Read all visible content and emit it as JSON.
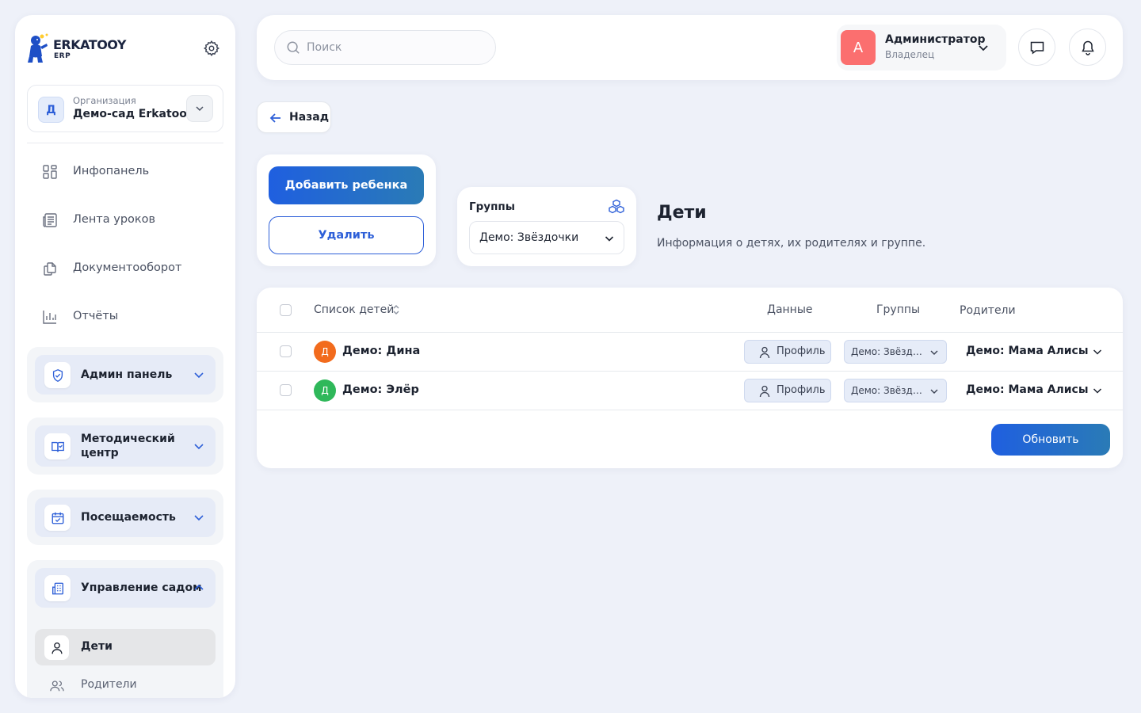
{
  "brand": {
    "name": "ERKATOOY",
    "sub": "ERP"
  },
  "org": {
    "caption": "Организация",
    "name": "Демо-сад Erkatooy",
    "avatar_letter": "Д"
  },
  "nav": {
    "items": [
      {
        "label": "Инфопанель",
        "icon": "dashboard-icon"
      },
      {
        "label": "Лента уроков",
        "icon": "news-feed-icon"
      },
      {
        "label": "Документооборот",
        "icon": "documents-icon"
      },
      {
        "label": "Отчёты",
        "icon": "chart-icon"
      }
    ],
    "groups": [
      {
        "label": "Админ панель",
        "icon": "shield-icon"
      },
      {
        "label_line1": "Методический",
        "label_line2": "центр",
        "icon": "book-icon"
      },
      {
        "label": "Посещаемость",
        "icon": "calendar-check-icon"
      },
      {
        "label": "Управление садом",
        "icon": "building-icon",
        "children": [
          {
            "label": "Дети",
            "active": true
          },
          {
            "label": "Родители",
            "active": false
          }
        ]
      }
    ]
  },
  "header": {
    "search_placeholder": "Поиск",
    "user": {
      "avatar_letter": "А",
      "name": "Администратор",
      "role": "Владелец"
    }
  },
  "page": {
    "back_label": "Назад",
    "add_child_label": "Добавить ребенка",
    "delete_label": "Удалить",
    "groups_title": "Группы",
    "groups_selected": "Демо: Звёздочки",
    "title": "Дети",
    "description": "Информация о детях, их родителях и группе."
  },
  "table": {
    "headers": {
      "children": "Список детей",
      "data": "Данные",
      "groups": "Группы",
      "parents": "Родители"
    },
    "rows": [
      {
        "avatar_letter": "Д",
        "avatar_color": "#f26b1d",
        "name": "Демо: Дина",
        "profile_label": "Профиль",
        "group": "Демо: Звёздоч...",
        "parent": "Демо: Мама Алисы"
      },
      {
        "avatar_letter": "Д",
        "avatar_color": "#2fb85a",
        "name": "Демо: Элёр",
        "profile_label": "Профиль",
        "group": "Демо: Звёздоч...",
        "parent": "Демо: Мама Алисы"
      }
    ],
    "refresh_label": "Обновить"
  },
  "colors": {
    "accent": "#2d5fd8",
    "user_avatar": "#fb6f6f",
    "background": "#eef1f9"
  }
}
